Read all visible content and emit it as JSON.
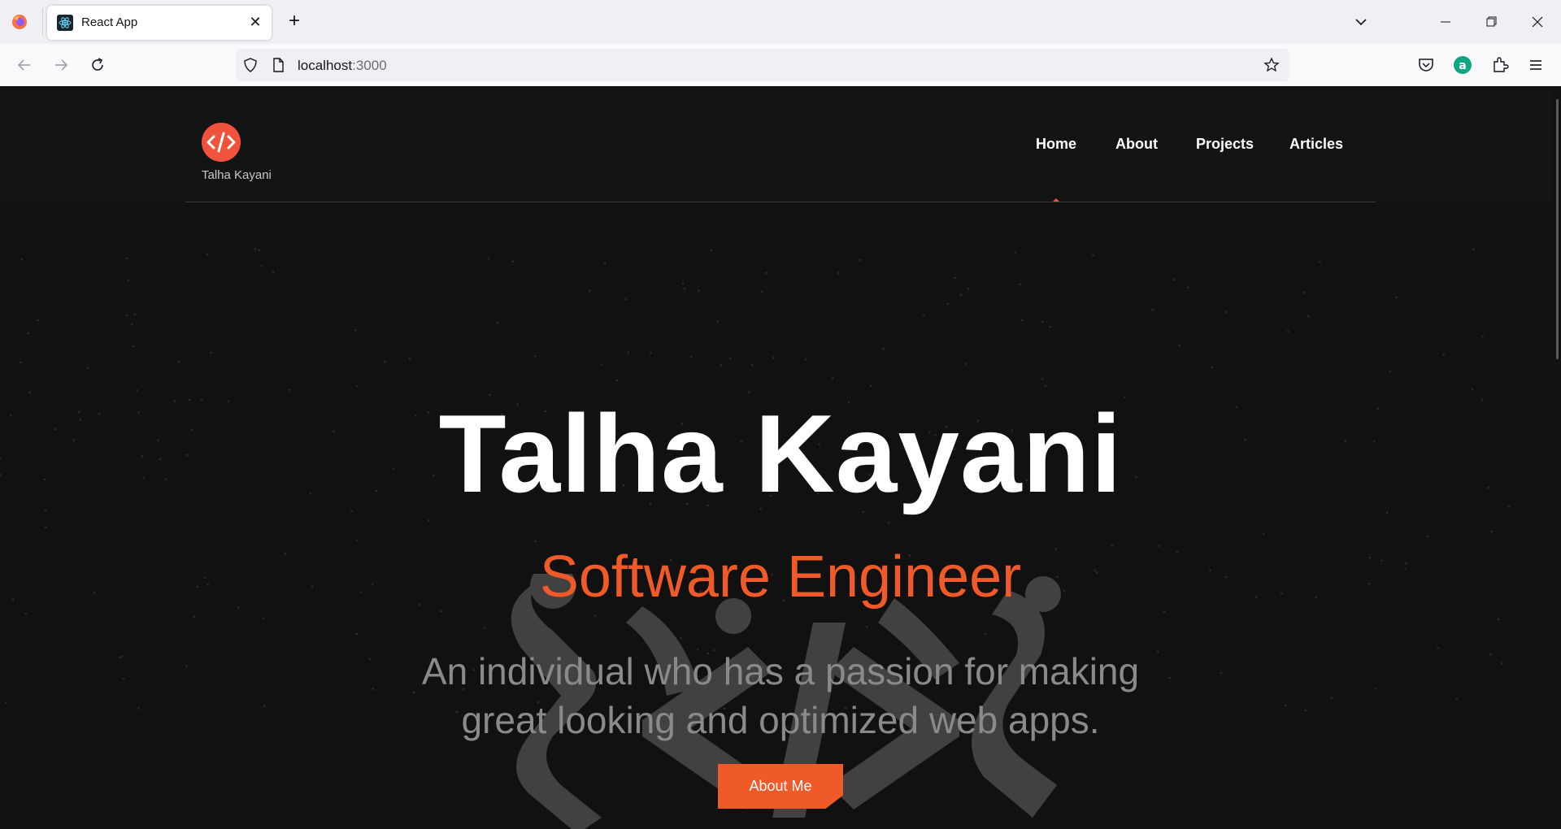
{
  "browser": {
    "tab_title": "React App",
    "tab_close": "✕",
    "new_tab": "+",
    "url_host": "localhost",
    "url_port": ":3000",
    "icons": [
      "firefox-icon",
      "react-favicon-icon",
      "tab-list-icon",
      "minimize-icon",
      "restore-icon",
      "window-close-icon",
      "back-icon",
      "forward-icon",
      "reload-icon",
      "shield-icon",
      "page-icon",
      "bookmark-star-icon",
      "pocket-icon",
      "account-icon",
      "extensions-icon",
      "app-menu-icon"
    ]
  },
  "site": {
    "brand_name": "Talha Kayani",
    "brand_logo_glyph": "</>",
    "accent_color": "#f05a28",
    "nav": [
      {
        "label": "Home",
        "active": true
      },
      {
        "label": "About",
        "active": false
      },
      {
        "label": "Projects",
        "active": false
      },
      {
        "label": "Articles",
        "active": false
      }
    ]
  },
  "hero": {
    "title": "Talha Kayani",
    "subtitle": "Software Engineer",
    "description_line1": "An individual who has a passion for making",
    "description_line2": "great looking and optimized web apps.",
    "cta_label": "About Me"
  }
}
